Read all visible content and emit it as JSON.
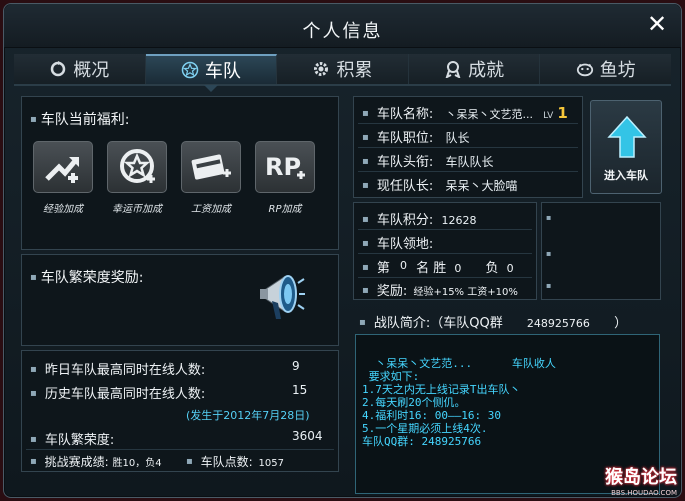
{
  "window": {
    "title": "个人信息",
    "close_icon": "close-icon"
  },
  "tabs": [
    {
      "label": "概况",
      "icon": "refresh-icon"
    },
    {
      "label": "车队",
      "icon": "star-icon",
      "active": true
    },
    {
      "label": "积累",
      "icon": "gear-icon"
    },
    {
      "label": "成就",
      "icon": "medal-icon"
    },
    {
      "label": "鱼坊",
      "icon": "fish-icon"
    }
  ],
  "benefits": {
    "heading": "车队当前福利:",
    "items": [
      {
        "label": "经验加成",
        "icon": "exp-up-icon"
      },
      {
        "label": "幸运币加成",
        "icon": "lucky-coin-icon"
      },
      {
        "label": "工资加成",
        "icon": "salary-card-icon"
      },
      {
        "label": "RP加成",
        "icon": "rp-plus-icon"
      }
    ]
  },
  "prosperity_reward": {
    "heading": "车队繁荣度奖励:",
    "icon": "megaphone-icon"
  },
  "stats": {
    "yesterday_online_label": "昨日车队最高同时在线人数:",
    "yesterday_online_value": "9",
    "history_online_label": "历史车队最高同时在线人数:",
    "history_online_value": "15",
    "history_date": "(发生于2012年7月28日)",
    "prosperity_label": "车队繁荣度:",
    "prosperity_value": "3604",
    "challenge_label": "挑战赛成绩:",
    "challenge_value": "胜10，负4",
    "points_label": "车队点数:",
    "points_value": "1057"
  },
  "team_info": {
    "name_label": "车队名称:",
    "name_value": "丶呆呆丶文艺范...",
    "level_prefix": "LV",
    "level": "1",
    "position_label": "车队职位:",
    "position_value": "队长",
    "title_label": "车队头衔:",
    "title_value": "车队队长",
    "leader_label": "现任队长:",
    "leader_value": "呆呆丶大脸喵"
  },
  "enter_button": {
    "label": "进入车队",
    "icon": "up-arrow-icon"
  },
  "team_score": {
    "score_label": "车队积分:",
    "score_value": "12628",
    "territory_label": "车队领地:",
    "rank_label_a": "第",
    "rank_value": "0",
    "rank_label_b": "名 胜",
    "win_value": "0",
    "lose_label": "负",
    "lose_value": "0",
    "reward_label": "奖励:",
    "reward_value": "经验+15% 工资+10%"
  },
  "intro": {
    "heading": "战队简介:（车队QQ群",
    "qq_value": "248925766",
    "heading_close": "）",
    "lines": [
      "  丶呆呆丶文艺范...      车队收人",
      " 要求如下:",
      "1.7天之内无上线记录T出车队丶",
      "2.每天刷20个侧仉。",
      "4.福利时16: 00——16: 30",
      "5.一个星期必须上线4次.",
      "车队QQ群: 248925766"
    ]
  },
  "watermark": {
    "text": "猴岛论坛",
    "sub": "BBS.HOUDAO.COM"
  }
}
